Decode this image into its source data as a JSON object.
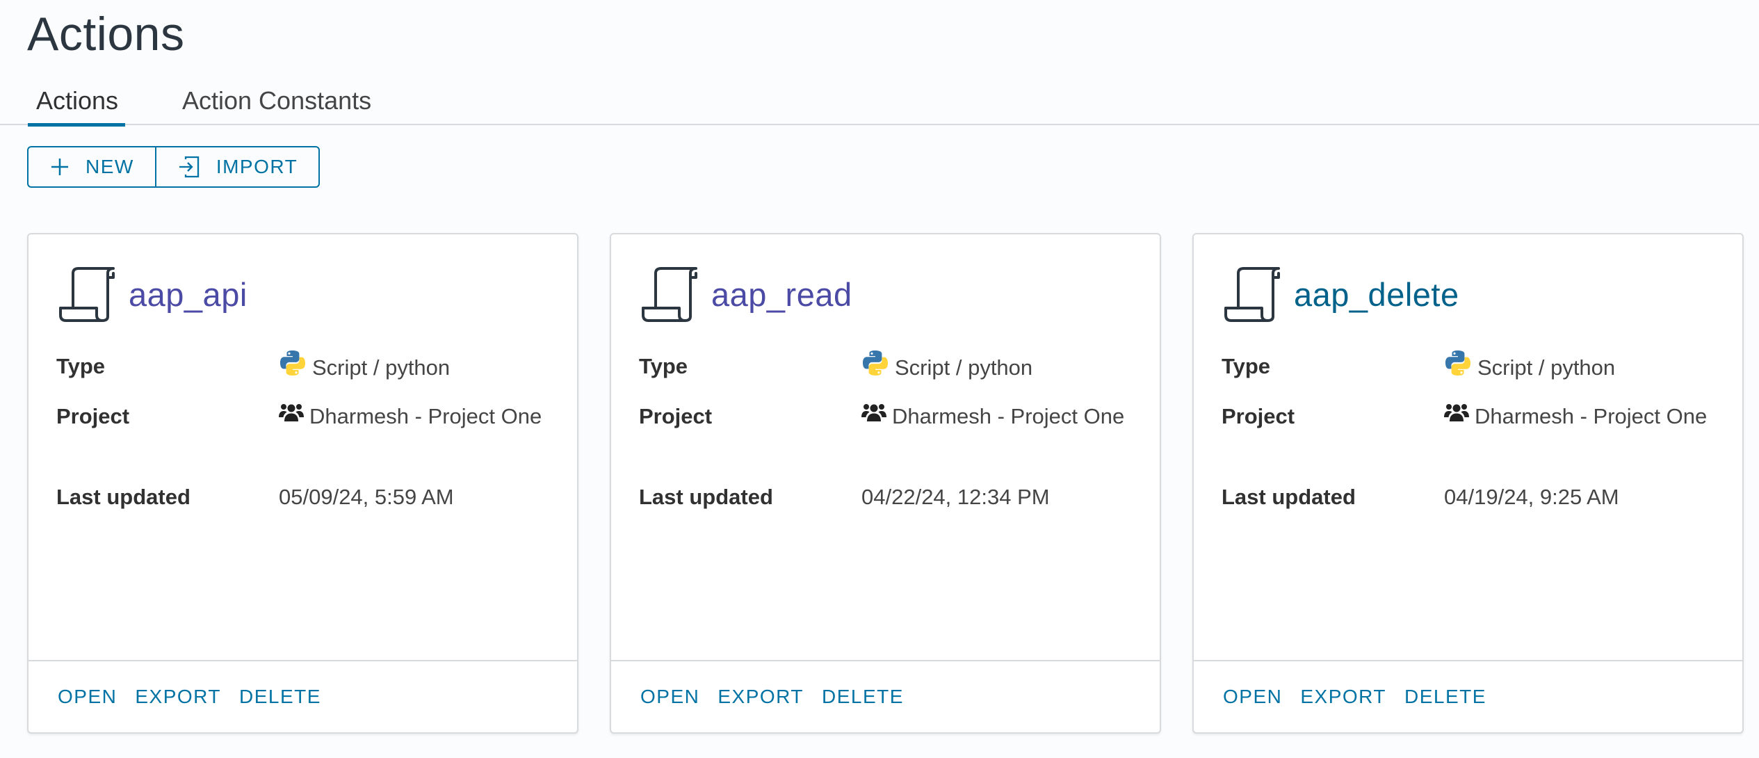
{
  "page": {
    "title": "Actions"
  },
  "tabs": [
    {
      "label": "Actions",
      "active": true
    },
    {
      "label": "Action Constants",
      "active": false
    }
  ],
  "toolbar": {
    "new_label": "NEW",
    "import_label": "IMPORT"
  },
  "labels": {
    "type": "Type",
    "project": "Project",
    "last_updated": "Last updated"
  },
  "cards": [
    {
      "name": "aap_api",
      "type": "Script / python",
      "project": "Dharmesh - Project One",
      "last_updated": "05/09/24, 5:59 AM"
    },
    {
      "name": "aap_read",
      "type": "Script / python",
      "project": "Dharmesh - Project One",
      "last_updated": "04/22/24, 12:34 PM"
    },
    {
      "name": "aap_delete",
      "type": "Script / python",
      "project": "Dharmesh - Project One",
      "last_updated": "04/19/24, 9:25 AM"
    }
  ],
  "card_actions": {
    "open": "OPEN",
    "export": "EXPORT",
    "delete": "DELETE"
  },
  "colors": {
    "accent": "#0072a3",
    "title_link": "#4b4aa5",
    "title_link_alt": "#00618a",
    "python_blue": "#3776ab",
    "python_yellow": "#ffd43b"
  },
  "icons": {
    "new": "plus-icon",
    "import": "import-icon",
    "card": "scroll-icon",
    "type": "python-icon",
    "project": "users-icon"
  }
}
